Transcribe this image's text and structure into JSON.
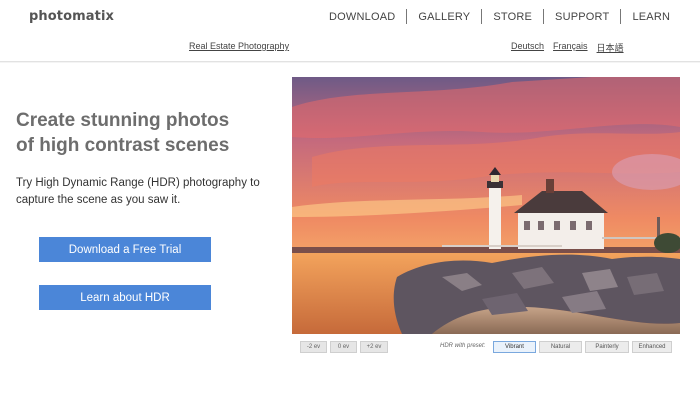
{
  "header": {
    "logo": "photomatix",
    "nav": [
      "DOWNLOAD",
      "GALLERY",
      "STORE",
      "SUPPORT",
      "LEARN"
    ],
    "real_estate_link": "Real Estate Photography",
    "languages": [
      "Deutsch",
      "Français",
      "日本語"
    ]
  },
  "hero": {
    "headline_line1": "Create stunning photos",
    "headline_line2": "of high contrast scenes",
    "subtext_line1": "Try High Dynamic Range (HDR) photography to",
    "subtext_line2": "capture the scene as you saw it.",
    "trial_button": "Download a Free Trial",
    "learn_button": "Learn about HDR"
  },
  "viewer": {
    "image": "lighthouse-sunset-photo",
    "ev_buttons": [
      "-2 ev",
      "0 ev",
      "+2 ev"
    ],
    "preset_label": "HDR with preset:",
    "presets": [
      "Vibrant",
      "Natural",
      "Painterly",
      "Enhanced"
    ],
    "active_preset": "Vibrant"
  },
  "colors": {
    "accent_button": "#4b86d8",
    "headline": "#6d6d6d"
  }
}
